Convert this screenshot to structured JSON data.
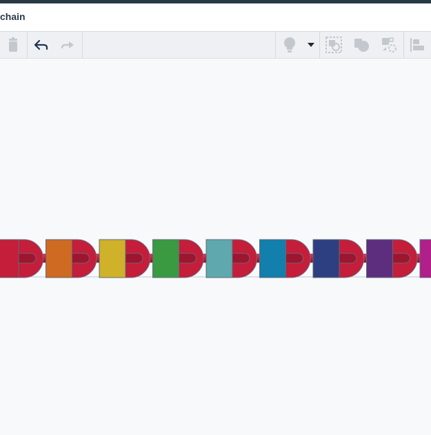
{
  "window": {
    "title": "chain"
  },
  "toolbar": {
    "buttons": [
      {
        "name": "delete",
        "icon": "trash-icon",
        "enabled": false
      },
      {
        "name": "undo",
        "icon": "undo-icon",
        "enabled": true
      },
      {
        "name": "redo",
        "icon": "redo-icon",
        "enabled": false
      },
      {
        "name": "notes",
        "icon": "lightbulb-icon",
        "enabled": false
      },
      {
        "name": "notes-dropdown",
        "icon": "caret-down-icon",
        "enabled": true
      },
      {
        "name": "group",
        "icon": "group-icon",
        "enabled": false
      },
      {
        "name": "solid-hole",
        "icon": "solid-hole-icon",
        "enabled": false
      },
      {
        "name": "mirror",
        "icon": "mirror-icon",
        "enabled": false
      },
      {
        "name": "align",
        "icon": "align-icon",
        "enabled": false
      }
    ]
  },
  "scene": {
    "link_color": "#c41e3a",
    "bar_color": "#d41f3f",
    "block_colors": [
      "#c41e3a",
      "#cf6a22",
      "#cfb12a",
      "#3a9a42",
      "#5fa8ad",
      "#127fad",
      "#2d3f80",
      "#5e2e7e",
      "#b01f8a"
    ]
  }
}
